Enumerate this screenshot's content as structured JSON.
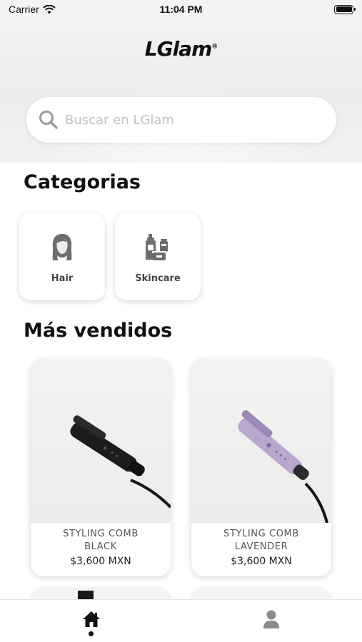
{
  "status_bar": {
    "carrier": "Carrier",
    "time": "11:04 PM"
  },
  "header": {
    "logo_text": "LGlam",
    "logo_mark": "®"
  },
  "search": {
    "placeholder": "Buscar en LGlam",
    "icon": "search-icon"
  },
  "categories": {
    "title": "Categorias",
    "items": [
      {
        "label": "Hair",
        "icon": "hair-icon"
      },
      {
        "label": "Skincare",
        "icon": "skincare-icon"
      }
    ]
  },
  "bestsellers": {
    "title": "Más vendidos",
    "products": [
      {
        "name": "STYLING COMB BLACK",
        "price": "$3,600 MXN",
        "color": "#1c1c1c"
      },
      {
        "name": "STYLING COMB LAVENDER",
        "price": "$3,600 MXN",
        "color": "#b9a7cf"
      }
    ]
  },
  "tabbar": {
    "items": [
      {
        "icon": "home-icon",
        "active": true
      },
      {
        "icon": "profile-icon",
        "active": false
      }
    ]
  },
  "colors": {
    "header_bg": "#f0f0f0",
    "text_primary": "#111111",
    "text_muted": "#555555",
    "icon_gray": "#666666"
  }
}
